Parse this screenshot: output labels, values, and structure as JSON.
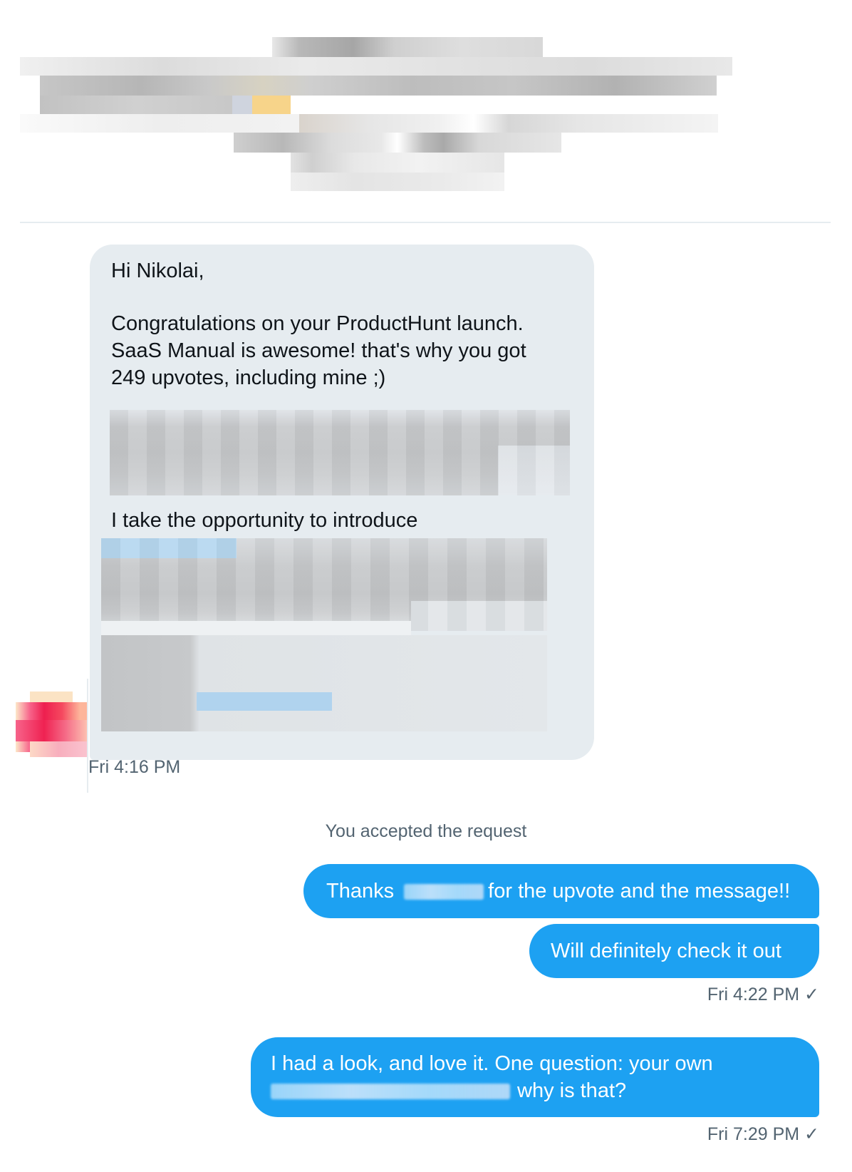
{
  "conversation": {
    "incoming_message": {
      "greeting": "Hi Nikolai,",
      "para1_line1": "Congratulations on your ProductHunt launch.",
      "para1_line2": "SaaS Manual is awesome! that's why you got",
      "para1_line3": "249 upvotes, including mine ;)",
      "para2_line1": "I take the opportunity to introduce",
      "timestamp": "Fri 4:16 PM"
    },
    "system_message": "You accepted the request",
    "outgoing_messages": [
      {
        "before": "Thanks",
        "after": "for the upvote and the message!!"
      },
      {
        "text": "Will definitely check it out"
      },
      {
        "line1": "I had a look, and love it. One question: your own",
        "line2_after": "why is that?"
      }
    ],
    "outgoing_timestamp_1": "Fri 4:22 PM ✓",
    "outgoing_timestamp_2": "Fri 7:29 PM ✓"
  },
  "colors": {
    "incoming_bubble": "#e6ecf0",
    "outgoing_bubble": "#1da1f2",
    "meta_text": "#536471"
  }
}
